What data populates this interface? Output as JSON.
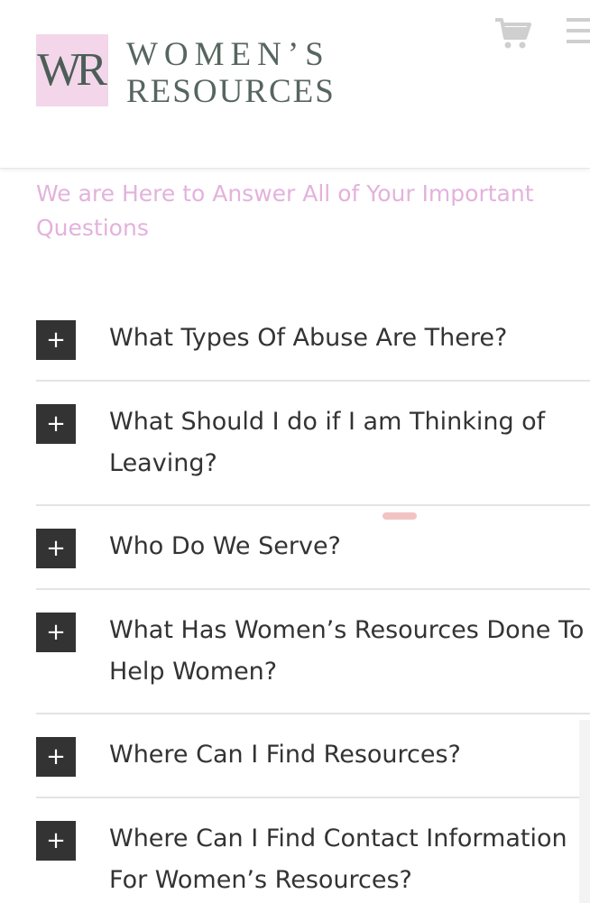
{
  "brand": {
    "mark": "WR",
    "line1": "WOMEN’S",
    "line2": "RESOURCES",
    "mark_bg": "#f3d6ea",
    "text_color": "#56665f"
  },
  "header_icons": {
    "cart": "shopping-cart-icon",
    "menu": "hamburger-menu-icon"
  },
  "subtitle": "We are Here to Answer All of Your Important Questions",
  "subtitle_color": "#e3b2dc",
  "faq": {
    "toggle_symbol": "+",
    "items": [
      {
        "question": "What Types Of Abuse Are There?"
      },
      {
        "question": "What Should I do if I am Thinking of Leaving?"
      },
      {
        "question": "Who Do We Serve?"
      },
      {
        "question": "What Has Women’s Resources Done To Help Women?"
      },
      {
        "question": "Where Can I Find Resources?"
      },
      {
        "question": "Where Can I Find Contact Information For Women’s Resources?"
      }
    ]
  }
}
